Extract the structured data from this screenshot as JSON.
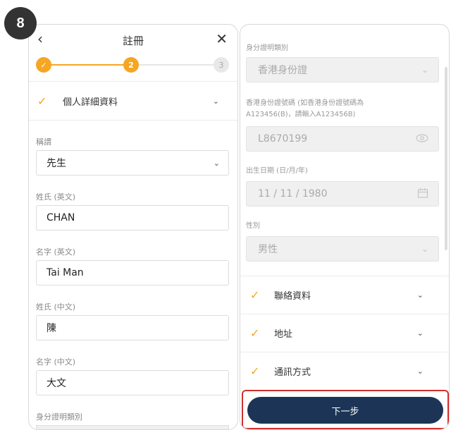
{
  "step_badge": "8",
  "left": {
    "header": {
      "back_glyph": "‹",
      "title": "註冊",
      "close_glyph": "✕"
    },
    "stepper": {
      "done_glyph": "✓",
      "current": "2",
      "next": "3"
    },
    "section": {
      "check": "✓",
      "title": "個人詳細資料",
      "chevron": "⌄"
    },
    "fields": {
      "salutation": {
        "label": "稱謂",
        "value": "先生"
      },
      "surname_en": {
        "label": "姓氏 (英文)",
        "value": "CHAN"
      },
      "given_en": {
        "label": "名字 (英文)",
        "value": "Tai Man"
      },
      "surname_zh": {
        "label": "姓氏 (中文)",
        "value": "陳"
      },
      "given_zh": {
        "label": "名字 (中文)",
        "value": "大文"
      },
      "id_type_label": "身分證明類別"
    }
  },
  "right": {
    "id_type": {
      "label": "身分證明類別",
      "value": "香港身份證"
    },
    "id_number": {
      "label_line1": "香港身份證號碼 (如香港身份證號碼為",
      "label_line2": "A123456(B)，請輸入A123456B)",
      "value": "L8670199"
    },
    "dob": {
      "label": "出生日期 (日/月/年)",
      "value": "11 / 11 / 1980"
    },
    "gender": {
      "label": "性別",
      "value": "男性"
    },
    "sections": [
      {
        "check": "✓",
        "title": "聯絡資料",
        "chevron": "⌄"
      },
      {
        "check": "✓",
        "title": "地址",
        "chevron": "⌄"
      },
      {
        "check": "✓",
        "title": "通訊方式",
        "chevron": "⌄"
      }
    ],
    "next_label": "下一步"
  },
  "icons": {
    "eye": "eye-icon",
    "calendar": "calendar-icon"
  },
  "colors": {
    "accent": "#f5a623",
    "primary": "#1c3557",
    "highlight": "#d32f2f"
  }
}
